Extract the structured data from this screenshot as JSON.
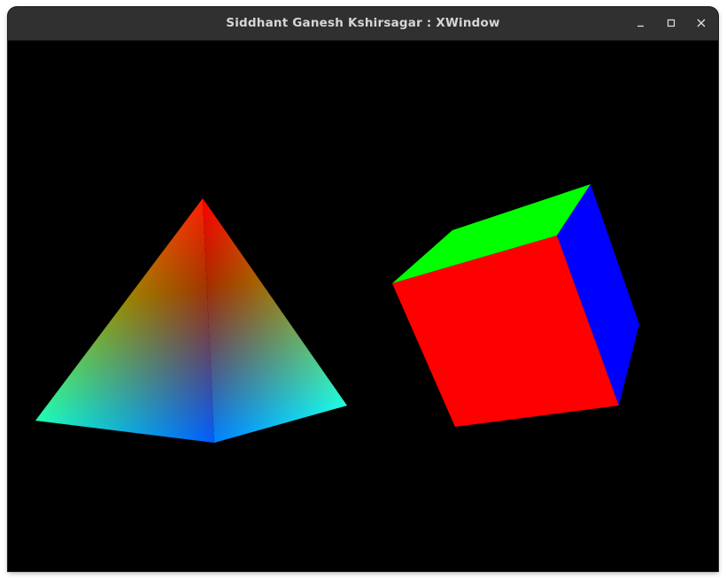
{
  "window": {
    "title": "Siddhant Ganesh Kshirsagar : XWindow",
    "controls": [
      {
        "name": "minimize",
        "icon": "minimize-icon"
      },
      {
        "name": "maximize",
        "icon": "maximize-icon"
      },
      {
        "name": "close",
        "icon": "close-icon"
      }
    ]
  },
  "scene": {
    "background_color": "#000000",
    "objects": [
      {
        "name": "pyramid",
        "shading": "smooth",
        "vertex_colors": [
          "#ff0000",
          "#00ff00",
          "#0000ff"
        ]
      },
      {
        "name": "cube",
        "shading": "flat",
        "face_colors": {
          "front": "#ff0000",
          "top": "#00ff00",
          "side": "#0000ff"
        }
      }
    ]
  }
}
